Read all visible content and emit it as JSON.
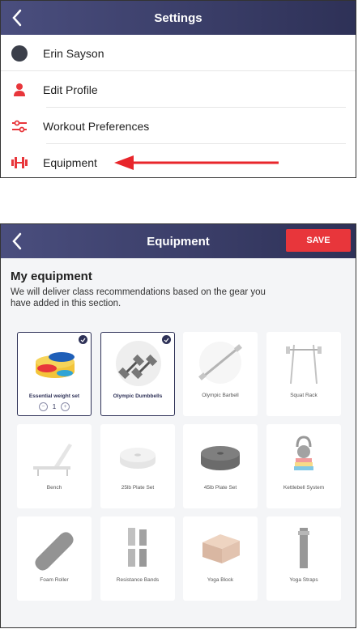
{
  "settings": {
    "title": "Settings",
    "user_name": "Erin Sayson",
    "items": [
      {
        "label": "Edit Profile",
        "icon": "person-icon"
      },
      {
        "label": "Workout Preferences",
        "icon": "sliders-icon"
      },
      {
        "label": "Equipment",
        "icon": "dumbbell-icon"
      }
    ]
  },
  "equipment": {
    "title": "Equipment",
    "save_label": "SAVE",
    "section_title": "My equipment",
    "section_subtitle": "We will deliver class recommendations based on the gear you have added in this section.",
    "items": [
      {
        "name": "Essential weight set",
        "selected": true,
        "quantity": "1"
      },
      {
        "name": "Olympic Dumbbells",
        "selected": true
      },
      {
        "name": "Olympic Barbell",
        "selected": false
      },
      {
        "name": "Squat Rack",
        "selected": false
      },
      {
        "name": "Bench",
        "selected": false
      },
      {
        "name": "25lb Plate Set",
        "selected": false
      },
      {
        "name": "45lb Plate Set",
        "selected": false
      },
      {
        "name": "Kettlebell System",
        "selected": false
      },
      {
        "name": "Foam Roller",
        "selected": false
      },
      {
        "name": "Resistance Bands",
        "selected": false
      },
      {
        "name": "Yoga Block",
        "selected": false
      },
      {
        "name": "Yoga Straps",
        "selected": false
      }
    ]
  },
  "colors": {
    "nav": "#2e3157",
    "accent_red": "#e8363b",
    "card_bg": "#ffffff",
    "panel_bg": "#f4f5f7"
  }
}
